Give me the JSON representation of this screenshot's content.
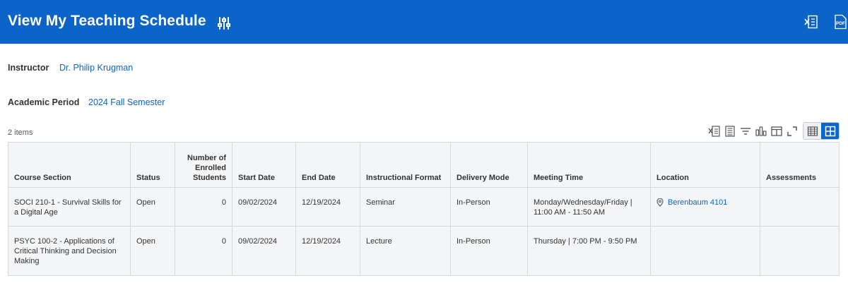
{
  "header": {
    "title": "View My Teaching Schedule",
    "color": "#0b64c8"
  },
  "fields": {
    "instructor_label": "Instructor",
    "instructor_value": "Dr. Philip Krugman",
    "period_label": "Academic Period",
    "period_value": "2024 Fall Semester"
  },
  "grid": {
    "items_count": "2 items",
    "columns": [
      "Course Section",
      "Status",
      "Number of Enrolled Students",
      "Start Date",
      "End Date",
      "Instructional Format",
      "Delivery Mode",
      "Meeting Time",
      "Location",
      "Assessments"
    ],
    "rows": [
      {
        "course_section": "SOCI 210-1 - Survival Skills for a Digital Age",
        "status": "Open",
        "enrolled": "0",
        "start_date": "09/02/2024",
        "end_date": "12/19/2024",
        "format": "Seminar",
        "delivery": "In-Person",
        "meeting_time": "Monday/Wednesday/Friday | 11:00 AM - 11:50 AM",
        "location": "Berenbaum 4101",
        "assessments": ""
      },
      {
        "course_section": "PSYC 100-2 - Applications of Critical Thinking and Decision Making",
        "status": "Open",
        "enrolled": "0",
        "start_date": "09/02/2024",
        "end_date": "12/19/2024",
        "format": "Lecture",
        "delivery": "In-Person",
        "meeting_time": "Thursday | 7:00 PM - 9:50 PM",
        "location": "",
        "assessments": ""
      }
    ]
  },
  "icons": {
    "header": [
      "filter-icon",
      "excel-export-icon",
      "pdf-export-icon"
    ],
    "toolbar": [
      "excel-export-icon",
      "column-settings-icon",
      "filter-icon",
      "chart-icon",
      "layout-icon",
      "fullscreen-icon",
      "table-view-icon",
      "grid-view-icon"
    ],
    "location": "location-pin-icon"
  }
}
